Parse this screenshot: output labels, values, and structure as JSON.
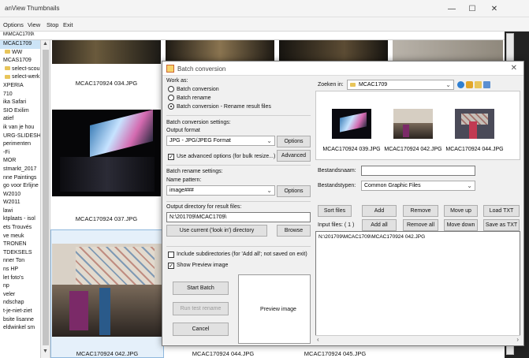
{
  "window": {
    "title": "anView Thumbnails",
    "menu": [
      "Options",
      "View",
      "Stop",
      "Exit"
    ],
    "path": "M\\MCAC1709\\"
  },
  "tree": {
    "items": [
      {
        "label": "MCAC1709",
        "selected": true
      },
      {
        "label": "WW",
        "folder": true
      },
      {
        "label": "MCAS1709"
      },
      {
        "label": "select-scou",
        "folder": true
      },
      {
        "label": "select-werk",
        "folder": true
      },
      {
        "label": "XPERIA"
      },
      {
        "label": "710"
      },
      {
        "label": "ika Safari"
      },
      {
        "label": "SIO Exilim"
      },
      {
        "label": "atief"
      },
      {
        "label": "ik van je hou"
      },
      {
        "label": "URG-SLIDESH"
      },
      {
        "label": "perimenten"
      },
      {
        "label": "-Fi"
      },
      {
        "label": "MOR"
      },
      {
        "label": "stmarkt_2017"
      },
      {
        "label": "nne Paintings"
      },
      {
        "label": "go voor Erlijne"
      },
      {
        "label": "W2010"
      },
      {
        "label": "W2011"
      },
      {
        "label": "lawi"
      },
      {
        "label": "ktplaats - isol"
      },
      {
        "label": "ets Trouvés"
      },
      {
        "label": "ve meuk"
      },
      {
        "label": "TRONEN"
      },
      {
        "label": "TDEKSELS"
      },
      {
        "label": "nner Ton"
      },
      {
        "label": "ns HP"
      },
      {
        "label": "let foto's"
      },
      {
        "label": "np"
      },
      {
        "label": "veler"
      },
      {
        "label": "ndschap"
      },
      {
        "label": "t-je-niet-ziet"
      },
      {
        "label": "bsite lisanne"
      },
      {
        "label": "eldwinkel sm"
      }
    ]
  },
  "thumbs": {
    "captions": [
      "MCAC170924 034.JPG",
      "MCAC170924 037.JPG",
      "MCAC170924 042.JPG",
      "MCAC170924 044.JPG",
      "MCAC170924 045.JPG"
    ]
  },
  "dialog": {
    "title": "Batch conversion",
    "work_as_label": "Work as:",
    "modes": [
      {
        "label": "Batch conversion",
        "selected": false
      },
      {
        "label": "Batch rename",
        "selected": false
      },
      {
        "label": "Batch conversion - Rename result files",
        "selected": true
      }
    ],
    "conversion_settings_label": "Batch conversion settings:",
    "output_format_label": "Output format",
    "output_format_value": "JPG - JPG/JPEG Format",
    "options_label": "Options",
    "advanced_check_label": "Use advanced options (for bulk resize...)",
    "advanced_checked": true,
    "advanced_label": "Advanced",
    "rename_settings_label": "Batch rename settings:",
    "name_pattern_label": "Name pattern:",
    "name_pattern_value": "image###",
    "rename_options_label": "Options",
    "output_dir_label": "Output directory for result files:",
    "output_dir_value": "N:\\201709\\MCAC1709\\",
    "use_current_label": "Use current ('look in') directory",
    "browse_label": "Browse",
    "include_sub_label": "Include subdirectories (for 'Add all'; not saved on exit)",
    "include_sub_checked": false,
    "show_preview_label": "Show Preview image",
    "show_preview_checked": true,
    "start_batch_label": "Start Batch",
    "run_test_label": "Run test rename",
    "cancel_label": "Cancel",
    "preview_label": "Preview image",
    "look_in_label": "Zoeken in:",
    "look_in_value": "MCAC1709",
    "file_thumbs": [
      "MCAC170924 039.JPG",
      "MCAC170924 042.JPG",
      "MCAC170924 044.JPG"
    ],
    "filename_label": "Bestandsnaam:",
    "filename_value": "",
    "filetype_label": "Bestandstypen:",
    "filetype_value": "Common Graphic Files",
    "sort_files_label": "Sort files",
    "add_label": "Add",
    "remove_label": "Remove",
    "move_up_label": "Move up",
    "load_txt_label": "Load TXT",
    "input_files_label": "Input files: ( 1 )",
    "add_all_label": "Add all",
    "remove_all_label": "Remove all",
    "move_down_label": "Move down",
    "save_txt_label": "Save as TXT",
    "input_files": [
      "N:\\201709\\MCAC1709\\MCAC170924 042.JPG"
    ]
  },
  "colors": {
    "selection": "#cce4f7",
    "folder": "#e8c55a",
    "dialog_bg": "#f0f0f0",
    "button_bg": "#e1e1e1"
  }
}
